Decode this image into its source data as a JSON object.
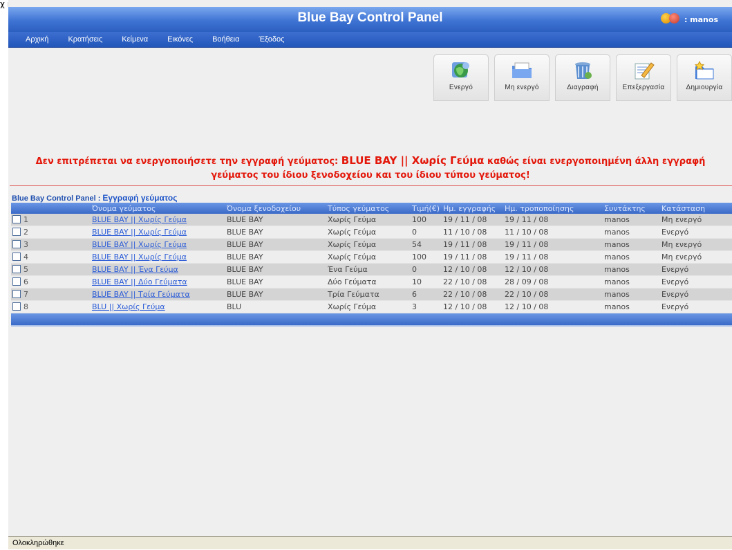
{
  "app": {
    "title": "Blue Bay Control Panel",
    "user_label": ": manos",
    "top_fragment": "χ ή"
  },
  "nav": [
    "Αρχική",
    "Κρατήσεις",
    "Κείμενα",
    "Εικόνες",
    "Βοήθεια",
    "Έξοδος"
  ],
  "toolbar": [
    {
      "label": "Ενεργό",
      "icon": "activate-globe-icon"
    },
    {
      "label": "Μη ενεργό",
      "icon": "inactive-folder-icon"
    },
    {
      "label": "Διαγραφή",
      "icon": "delete-trash-icon"
    },
    {
      "label": "Επεξεργασία",
      "icon": "edit-pencil-icon"
    },
    {
      "label": "Δημιουργία",
      "icon": "create-new-icon"
    }
  ],
  "error": {
    "prefix": "Δεν επιτρέπεται να ενεργοποιήσετε την εγγραφή γεύματος: ",
    "highlight": "BLUE BAY || Χωρίς Γεύμα",
    "suffix": " καθώς είναι ενεργοποιημένη άλλη εγγραφή γεύματος του ίδιου ξενοδοχείου και του ίδιου τύπου γεύματος!"
  },
  "breadcrumb": {
    "app": "Blue Bay Control Panel",
    "separator": " : ",
    "page": "Εγγραφή γεύματος"
  },
  "table": {
    "headers": [
      "",
      "Όνομα γεύματος",
      "Όνομα ξενοδοχείου",
      "Τύπος γεύματος",
      "Τιμή(€)",
      "Ημ. εγγραφής",
      "Ημ. τροποποίησης",
      "Συντάκτης",
      "Κατάσταση"
    ],
    "rows": [
      {
        "n": "1",
        "meal": "BLUE BAY || Χωρίς Γεύμα",
        "hotel": "BLUE BAY",
        "type": "Χωρίς Γεύμα",
        "price": "100",
        "created": "19 / 11 / 08",
        "modified": "19 / 11 / 08",
        "author": "manos",
        "status": "Μη ενεργό"
      },
      {
        "n": "2",
        "meal": "BLUE BAY || Χωρίς Γεύμα",
        "hotel": "BLUE BAY",
        "type": "Χωρίς Γεύμα",
        "price": "0",
        "created": "11 / 10 / 08",
        "modified": "11 / 10 / 08",
        "author": "manos",
        "status": "Ενεργό"
      },
      {
        "n": "3",
        "meal": "BLUE BAY || Χωρίς Γεύμα",
        "hotel": "BLUE BAY",
        "type": "Χωρίς Γεύμα",
        "price": "54",
        "created": "19 / 11 / 08",
        "modified": "19 / 11 / 08",
        "author": "manos",
        "status": "Μη ενεργό"
      },
      {
        "n": "4",
        "meal": "BLUE BAY || Χωρίς Γεύμα",
        "hotel": "BLUE BAY",
        "type": "Χωρίς Γεύμα",
        "price": "100",
        "created": "19 / 11 / 08",
        "modified": "19 / 11 / 08",
        "author": "manos",
        "status": "Μη ενεργό"
      },
      {
        "n": "5",
        "meal": "BLUE BAY || Ένα Γεύμα",
        "hotel": "BLUE BAY",
        "type": "Ένα Γεύμα",
        "price": "0",
        "created": "12 / 10 / 08",
        "modified": "12 / 10 / 08",
        "author": "manos",
        "status": "Ενεργό"
      },
      {
        "n": "6",
        "meal": "BLUE BAY || Δύο Γεύματα",
        "hotel": "BLUE BAY",
        "type": "Δύο Γεύματα",
        "price": "10",
        "created": "22 / 10 / 08",
        "modified": "28 / 09 / 08",
        "author": "manos",
        "status": "Ενεργό"
      },
      {
        "n": "7",
        "meal": "BLUE BAY || Τρία Γεύματα",
        "hotel": "BLUE BAY",
        "type": "Τρία Γεύματα",
        "price": "6",
        "created": "22 / 10 / 08",
        "modified": "22 / 10 / 08",
        "author": "manos",
        "status": "Ενεργό"
      },
      {
        "n": "8",
        "meal": "BLU || Χωρίς Γεύμα",
        "hotel": "BLU",
        "type": "Χωρίς Γεύμα",
        "price": "3",
        "created": "12 / 10 / 08",
        "modified": "12 / 10 / 08",
        "author": "manos",
        "status": "Ενεργό"
      }
    ]
  },
  "status_bar": "Ολοκληρώθηκε",
  "colors": {
    "header_blue": "#3f74d4",
    "error_red": "#e3170a",
    "link_blue": "#2a5bd7"
  }
}
